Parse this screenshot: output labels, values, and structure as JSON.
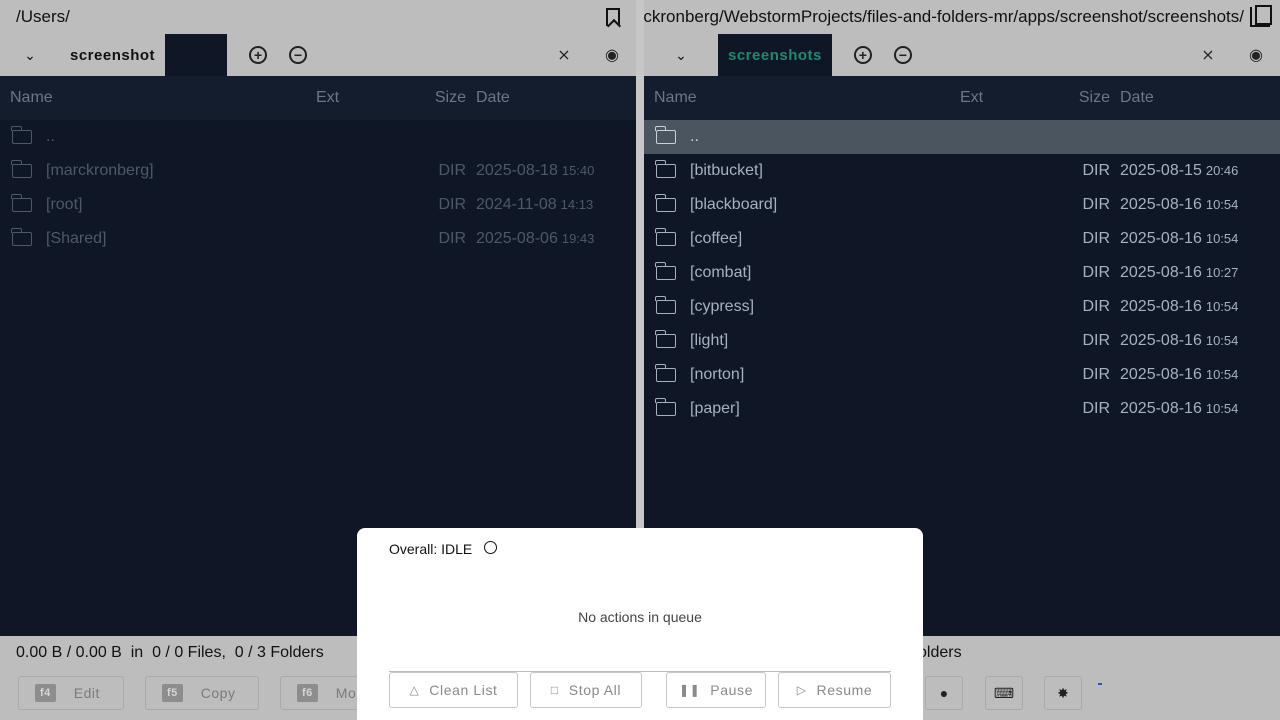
{
  "left_pane": {
    "path": "/Users/",
    "tabs": [
      "screenshot",
      ""
    ],
    "headers": {
      "name": "Name",
      "ext": "Ext",
      "size": "Size",
      "date": "Date"
    },
    "rows": [
      {
        "name": "..",
        "ext": "",
        "size": "",
        "date": "",
        "time": ""
      },
      {
        "name": "[marckronberg]",
        "ext": "",
        "size": "DIR",
        "date": "2025-08-18",
        "time": "15:40"
      },
      {
        "name": "[root]",
        "ext": "",
        "size": "DIR",
        "date": "2024-11-08",
        "time": "14:13"
      },
      {
        "name": "[Shared]",
        "ext": "",
        "size": "DIR",
        "date": "2025-08-06",
        "time": "19:43"
      }
    ]
  },
  "right_pane": {
    "path": "/Users/marckronberg/WebstormProjects/files-and-folders-mr/apps/screenshot/screenshots/",
    "tabs": [
      "screenshots"
    ],
    "headers": {
      "name": "Name",
      "ext": "Ext",
      "size": "Size",
      "date": "Date"
    },
    "rows": [
      {
        "name": "..",
        "ext": "",
        "size": "",
        "date": "",
        "time": ""
      },
      {
        "name": "[bitbucket]",
        "ext": "",
        "size": "DIR",
        "date": "2025-08-15",
        "time": "20:46"
      },
      {
        "name": "[blackboard]",
        "ext": "",
        "size": "DIR",
        "date": "2025-08-16",
        "time": "10:54"
      },
      {
        "name": "[coffee]",
        "ext": "",
        "size": "DIR",
        "date": "2025-08-16",
        "time": "10:54"
      },
      {
        "name": "[combat]",
        "ext": "",
        "size": "DIR",
        "date": "2025-08-16",
        "time": "10:27"
      },
      {
        "name": "[cypress]",
        "ext": "",
        "size": "DIR",
        "date": "2025-08-16",
        "time": "10:54"
      },
      {
        "name": "[light]",
        "ext": "",
        "size": "DIR",
        "date": "2025-08-16",
        "time": "10:54"
      },
      {
        "name": "[norton]",
        "ext": "",
        "size": "DIR",
        "date": "2025-08-16",
        "time": "10:54"
      },
      {
        "name": "[paper]",
        "ext": "",
        "size": "DIR",
        "date": "2025-08-16",
        "time": "10:54"
      }
    ]
  },
  "status": {
    "left": "0.00 B / 0.00 B  in  0 / 0 Files,  0 / 3 Folders",
    "right": "olders"
  },
  "function_keys": [
    {
      "key": "f4",
      "label": "Edit"
    },
    {
      "key": "f5",
      "label": "Copy"
    },
    {
      "key": "f6",
      "label": "Mo"
    }
  ],
  "modal": {
    "overall_label": "Overall: IDLE",
    "empty_message": "No actions in queue",
    "buttons": {
      "clean": "Clean List",
      "stop": "Stop All",
      "pause": "Pause",
      "resume": "Resume"
    }
  },
  "colors": {
    "background": "#0f1726",
    "chrome": "#bdbdbd",
    "active_tab_text": "#1e8a6e",
    "selected_row": "#4a5560"
  }
}
